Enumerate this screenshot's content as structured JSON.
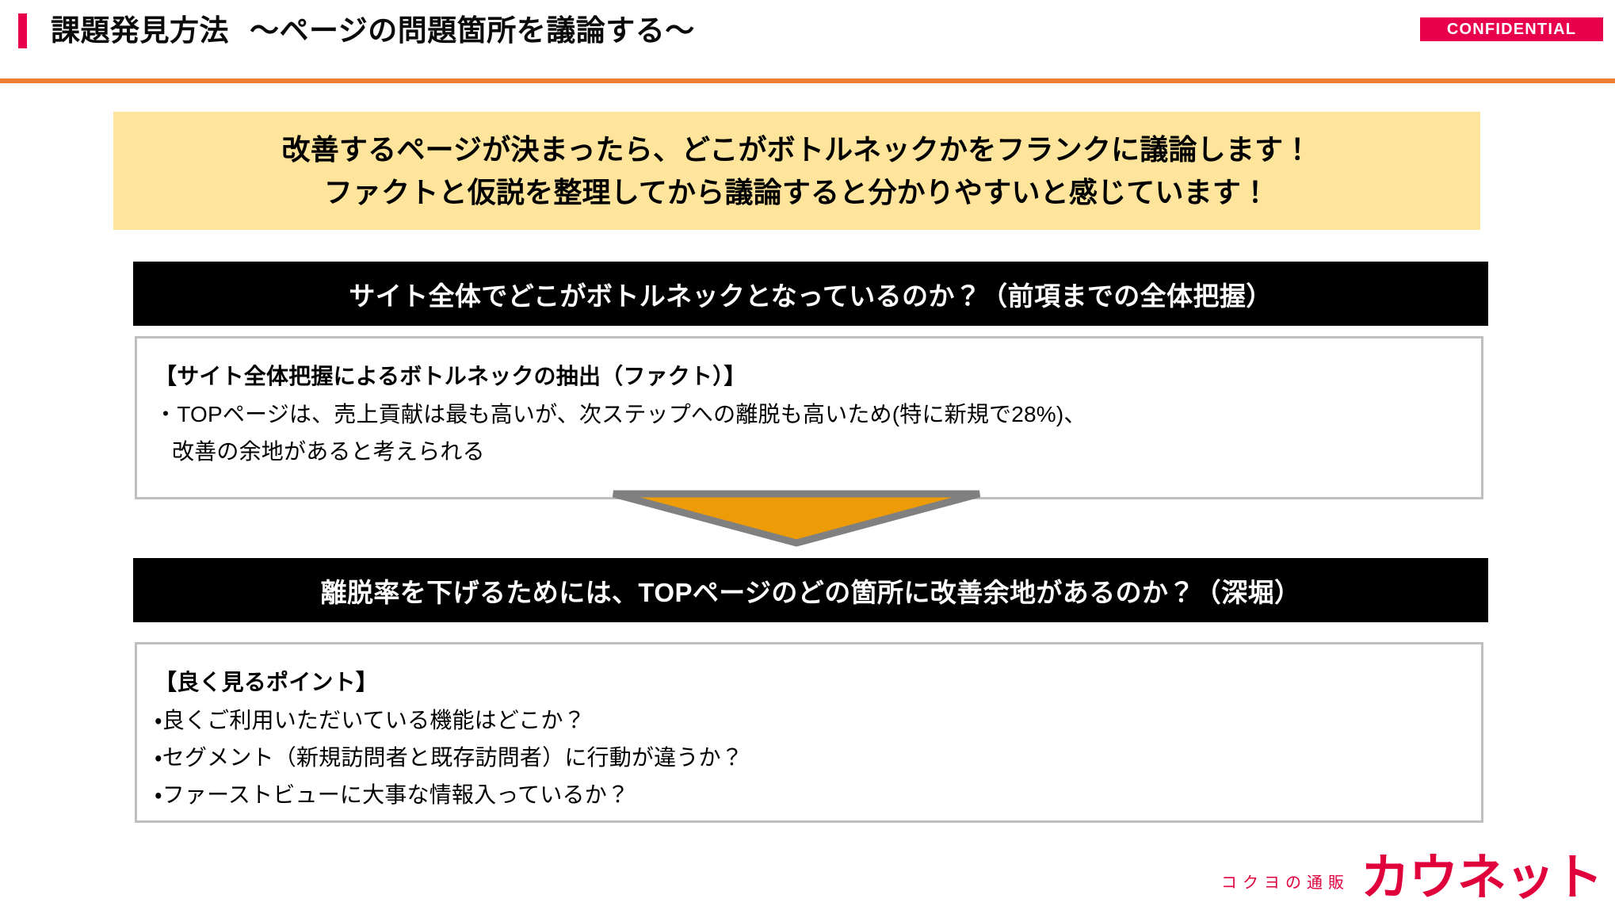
{
  "header": {
    "title_main": "課題発見方法",
    "title_sub": "～ページの問題箇所を議論する～",
    "confidential_label": "CONFIDENTIAL",
    "accent_color": "#E8004C",
    "rule_color": "#ED7D31"
  },
  "lead": {
    "background_color": "#FFE49B",
    "lines": [
      "改善するページが決まったら、どこがボトルネックかをフランクに議論します！",
      "ファクトと仮説を整理してから議論すると分かりやすいと感じています！"
    ]
  },
  "sections": [
    {
      "bar_label": "サイト全体でどこがボトルネックとなっているのか？（前項までの全体把握）",
      "heading": "【サイト全体把握によるボトルネックの抽出（ファクト）】",
      "lines": [
        "・TOPページは、売上貢献は最も高いが、次ステップへの離脱も高いため(特に新規で28%)、",
        "改善の余地があると考えられる"
      ]
    },
    {
      "bar_label": "離脱率を下げるためには、TOPページのどの箇所に改善余地があるのか？（深堀）",
      "heading": "【良く見るポイント】",
      "lines": [
        "・良くご利用いただいている機能はどこか？",
        "・セグメント（新規訪問者と既存訪問者）に行動が違うか？",
        "・ファーストビューに大事な情報入っているか？"
      ]
    }
  ],
  "arrow": {
    "fill_color": "#ED9B07",
    "stroke_color": "#808080"
  },
  "footer": {
    "logo_tagline": "コクヨの通販",
    "logo_name": "カウネット",
    "logo_color": "#E0003C"
  }
}
